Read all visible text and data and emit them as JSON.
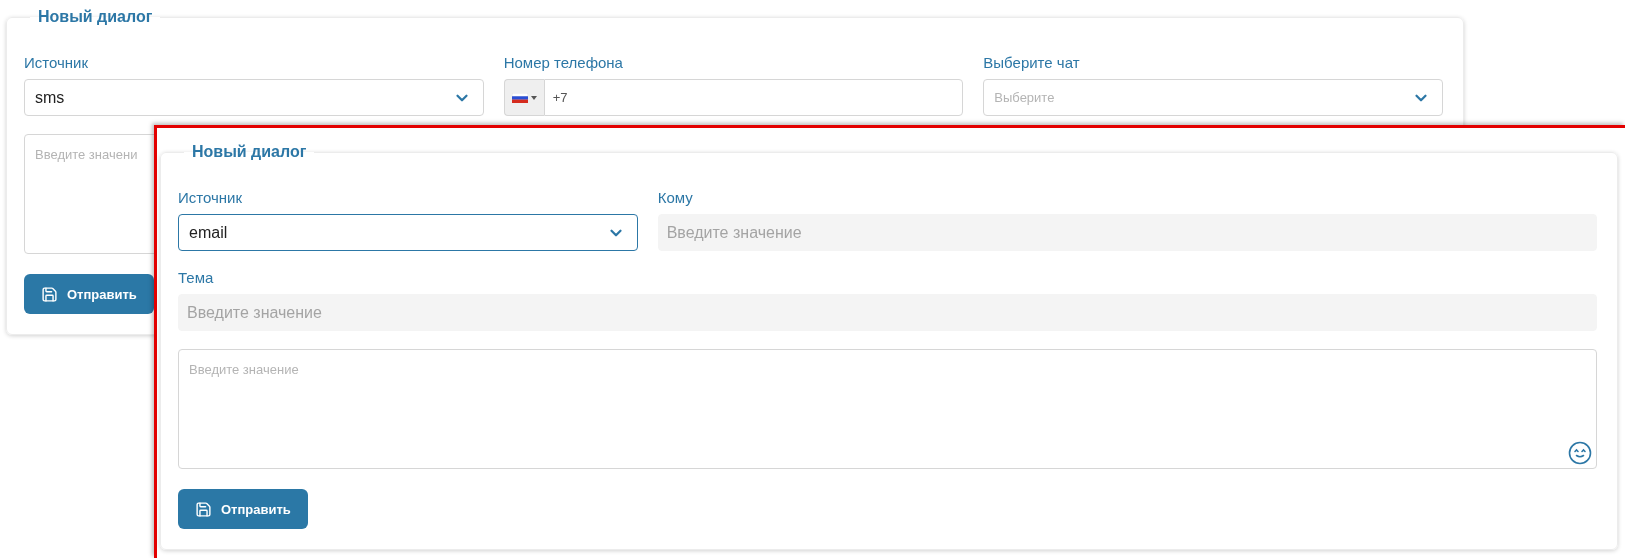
{
  "panels": [
    {
      "title": "Новый диалог",
      "highlighted": false,
      "rows": [
        [
          {
            "kind": "select",
            "label": "Источник",
            "value": "sms",
            "focused": false
          },
          {
            "kind": "phone",
            "label": "Номер телефона",
            "value": "+7"
          },
          {
            "kind": "select",
            "label": "Выберите чат",
            "placeholder": "Выберите",
            "focused": false
          }
        ],
        [
          {
            "kind": "textarea",
            "placeholder": "Введите значени"
          }
        ]
      ],
      "button": "Отправить"
    },
    {
      "title": "Новый диалог",
      "highlighted": true,
      "rows": [
        [
          {
            "kind": "select",
            "label": "Источник",
            "value": "email",
            "focused": true
          },
          {
            "kind": "text",
            "label": "Кому",
            "placeholder": "Введите значение",
            "disabled": true
          }
        ],
        [
          {
            "kind": "text",
            "label": "Тема",
            "placeholder": "Введите значение",
            "disabled": true
          }
        ],
        [
          {
            "kind": "textarea",
            "placeholder": "Введите значение",
            "emoji": true
          }
        ]
      ],
      "button": "Отправить"
    }
  ]
}
